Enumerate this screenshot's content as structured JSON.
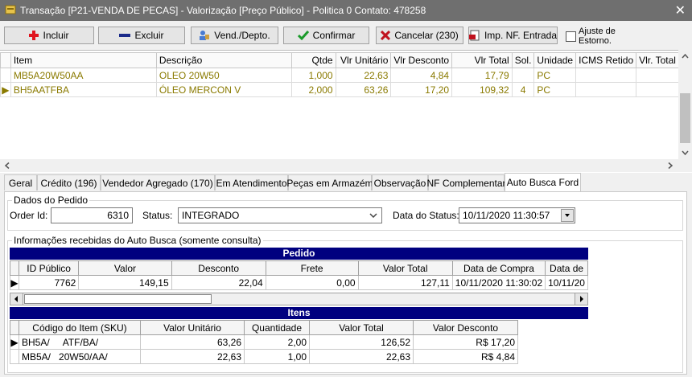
{
  "window": {
    "title": "Transação [P21-VENDA DE PECAS] - Valorização [Preço Público] - Politica 0  Contato: 478258",
    "close": "✕"
  },
  "toolbar": {
    "incluir": "Incluir",
    "excluir": "Excluir",
    "vend_depto": "Vend./Depto.",
    "confirmar": "Confirmar",
    "cancelar": "Cancelar (230)",
    "imp_nf": "Imp. NF. Entrada",
    "ajuste_estorno": "Ajuste de Estorno."
  },
  "items_grid": {
    "columns": [
      "Item",
      "Descrição",
      "Qtde",
      "Vlr Unitário",
      "Vlr Desconto",
      "Vlr Total",
      "Sol.",
      "Unidade",
      "ICMS Retido",
      "Vlr. Total c/I"
    ],
    "rows": [
      {
        "item": "MB5A20W50AA",
        "descricao": "OLEO 20W50",
        "qtde": "1,000",
        "vlr_unit": "22,63",
        "vlr_desc": "4,84",
        "vlr_total": "17,79",
        "sol": "",
        "unidade": "PC",
        "icms": "",
        "total_ci": ""
      },
      {
        "item": "BH5AATFBA",
        "descricao": "ÓLEO MERCON V",
        "qtde": "2,000",
        "vlr_unit": "63,26",
        "vlr_desc": "17,20",
        "vlr_total": "109,32",
        "sol": "4",
        "unidade": "PC",
        "icms": "",
        "total_ci": ""
      }
    ]
  },
  "tabs": [
    "Geral",
    "Crédito (196)",
    "Vendedor Agregado (170)",
    "Em Atendimento",
    "Peças em Armazém",
    "Observação",
    "NF Complementar",
    "Auto Busca Ford"
  ],
  "dados_pedido": {
    "title": "Dados do Pedido",
    "order_id_label": "Order Id:",
    "order_id": "6310",
    "status_label": "Status:",
    "status": "INTEGRADO",
    "data_status_label": "Data do Status:",
    "data_status": "10/11/2020 11:30:57"
  },
  "info": {
    "title": "Informações recebidas do Auto Busca (somente consulta)",
    "pedido": {
      "band": "Pedido",
      "columns": [
        "ID Público",
        "Valor",
        "Desconto",
        "Frete",
        "Valor Total",
        "Data de Compra",
        "Data de"
      ],
      "row": [
        "7762",
        "149,15",
        "22,04",
        "0,00",
        "127,11",
        "10/11/2020 11:30:02",
        "10/11/20"
      ]
    },
    "itens": {
      "band": "Itens",
      "columns": [
        "Código do Item (SKU)",
        "Valor Unitário",
        "Quantidade",
        "Valor Total",
        "Valor Desconto"
      ],
      "rows": [
        [
          "BH5A/     ATF/BA/",
          "63,26",
          "2,00",
          "126,52",
          "R$ 17,20"
        ],
        [
          "MB5A/   20W50/AA/",
          "22,63",
          "1,00",
          "22,63",
          "R$ 4,84"
        ]
      ]
    }
  },
  "colors": {
    "titlebar": "#6f6f6f",
    "band": "#00007f",
    "item_text": "#8a7a00",
    "incluir_icon": "#e0141e",
    "confirm_icon": "#1a9a2a",
    "cancel_icon": "#c0121e"
  }
}
